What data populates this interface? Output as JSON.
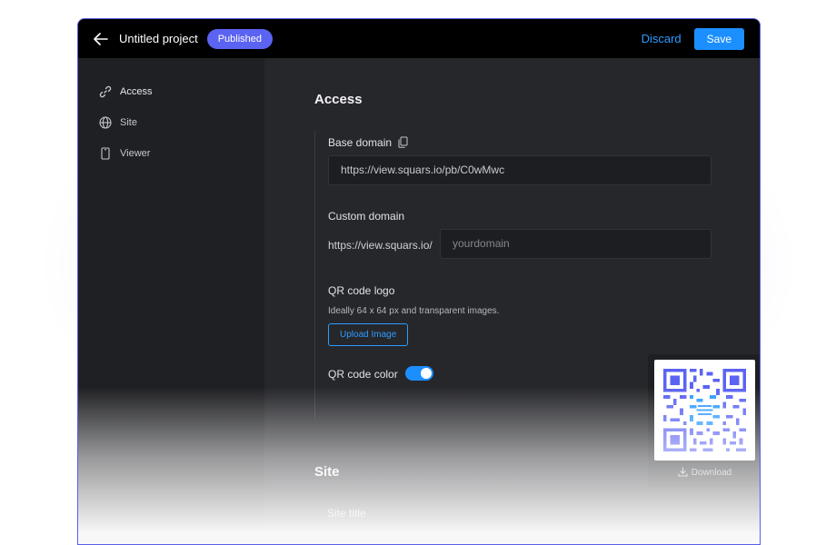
{
  "header": {
    "project_title": "Untitled project",
    "status_badge": "Published",
    "discard_label": "Discard",
    "save_label": "Save"
  },
  "sidebar": {
    "items": [
      {
        "label": "Access",
        "icon": "link-icon"
      },
      {
        "label": "Site",
        "icon": "globe-icon"
      },
      {
        "label": "Viewer",
        "icon": "phone-icon"
      }
    ]
  },
  "access": {
    "section_title": "Access",
    "base_domain_label": "Base domain",
    "base_domain_value": "https://view.squars.io/pb/C0wMwc",
    "custom_domain_label": "Custom domain",
    "custom_domain_prefix": "https://view.squars.io/",
    "custom_domain_placeholder": "yourdomain",
    "qr_logo_label": "QR code logo",
    "qr_logo_hint": "Ideally 64 x 64 px and transparent images.",
    "upload_label": "Upload Image",
    "qr_color_label": "QR code color",
    "qr_color_enabled": true,
    "download_label": "Download"
  },
  "site": {
    "section_title": "Site",
    "site_title_label": "Site title"
  },
  "colors": {
    "accent": "#1b8fff",
    "badge": "#5b63f2",
    "qr_primary": "#5b63f2",
    "qr_secondary": "#2e9bff"
  }
}
